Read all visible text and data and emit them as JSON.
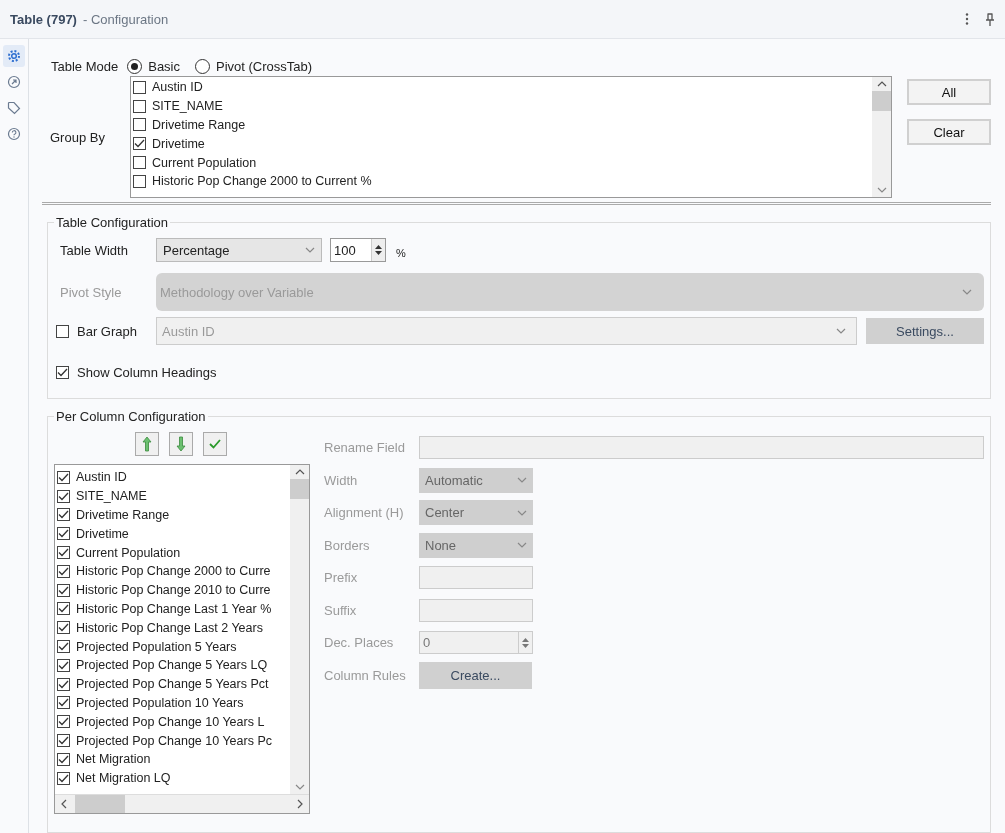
{
  "window": {
    "title": "Table (797)",
    "subtitle": "- Configuration"
  },
  "sidebar": {
    "items": [
      {
        "kind": "gear",
        "selected": true
      },
      {
        "kind": "arrow",
        "selected": false
      },
      {
        "kind": "tag",
        "selected": false
      },
      {
        "kind": "help",
        "selected": false
      }
    ]
  },
  "table_mode": {
    "label": "Table Mode",
    "options": [
      {
        "label": "Basic",
        "selected": true
      },
      {
        "label": "Pivot (CrossTab)",
        "selected": false
      }
    ]
  },
  "group_by": {
    "label": "Group By",
    "items": [
      {
        "label": "Austin ID",
        "checked": false
      },
      {
        "label": "SITE_NAME",
        "checked": false
      },
      {
        "label": "Drivetime Range",
        "checked": false
      },
      {
        "label": "Drivetime",
        "checked": true
      },
      {
        "label": "Current Population",
        "checked": false
      },
      {
        "label": "Historic Pop Change 2000 to Current %",
        "checked": false
      }
    ],
    "buttons": [
      "All",
      "Clear"
    ]
  },
  "table_configuration": {
    "title": "Table Configuration",
    "table_width": {
      "label": "Table Width",
      "value": "Percentage",
      "number": "100",
      "unit": "%"
    },
    "pivot_style": {
      "label": "Pivot Style",
      "value": "Methodology over Variable",
      "disabled": true
    },
    "bar_graph": {
      "label": "Bar Graph",
      "checked": false,
      "value": "Austin ID",
      "button": "Settings..."
    },
    "show_column_headings": {
      "label": "Show Column Headings",
      "checked": true
    }
  },
  "per_column_configuration": {
    "title": "Per Column Configuration",
    "columns": [
      {
        "label": "Austin ID",
        "checked": true
      },
      {
        "label": "SITE_NAME",
        "checked": true
      },
      {
        "label": "Drivetime Range",
        "checked": true
      },
      {
        "label": "Drivetime",
        "checked": true
      },
      {
        "label": "Current Population",
        "checked": true
      },
      {
        "label": "Historic Pop Change 2000 to Curre",
        "checked": true
      },
      {
        "label": "Historic Pop Change 2010 to Curre",
        "checked": true
      },
      {
        "label": "Historic Pop Change Last 1 Year %",
        "checked": true
      },
      {
        "label": "Historic Pop Change Last 2 Years",
        "checked": true
      },
      {
        "label": "Projected Population 5 Years",
        "checked": true
      },
      {
        "label": "Projected Pop Change 5 Years LQ",
        "checked": true
      },
      {
        "label": "Projected Pop Change 5 Years Pct",
        "checked": true
      },
      {
        "label": "Projected Population 10 Years",
        "checked": true
      },
      {
        "label": "Projected Pop Change 10 Years L",
        "checked": true
      },
      {
        "label": "Projected Pop Change 10 Years Pc",
        "checked": true
      },
      {
        "label": "Net Migration",
        "checked": true
      },
      {
        "label": "Net Migration LQ",
        "checked": true
      }
    ],
    "fields": [
      {
        "kind": "text",
        "label": "Rename Field"
      },
      {
        "kind": "select",
        "label": "Width",
        "value": "Automatic"
      },
      {
        "kind": "select",
        "label": "Alignment (H)",
        "value": "Center"
      },
      {
        "kind": "select",
        "label": "Borders",
        "value": "None"
      },
      {
        "kind": "short_text",
        "label": "Prefix"
      },
      {
        "kind": "short_text",
        "label": "Suffix"
      },
      {
        "kind": "spin",
        "label": "Dec. Places",
        "value": "0"
      },
      {
        "kind": "button",
        "label": "Column Rules",
        "button": "Create..."
      }
    ]
  }
}
